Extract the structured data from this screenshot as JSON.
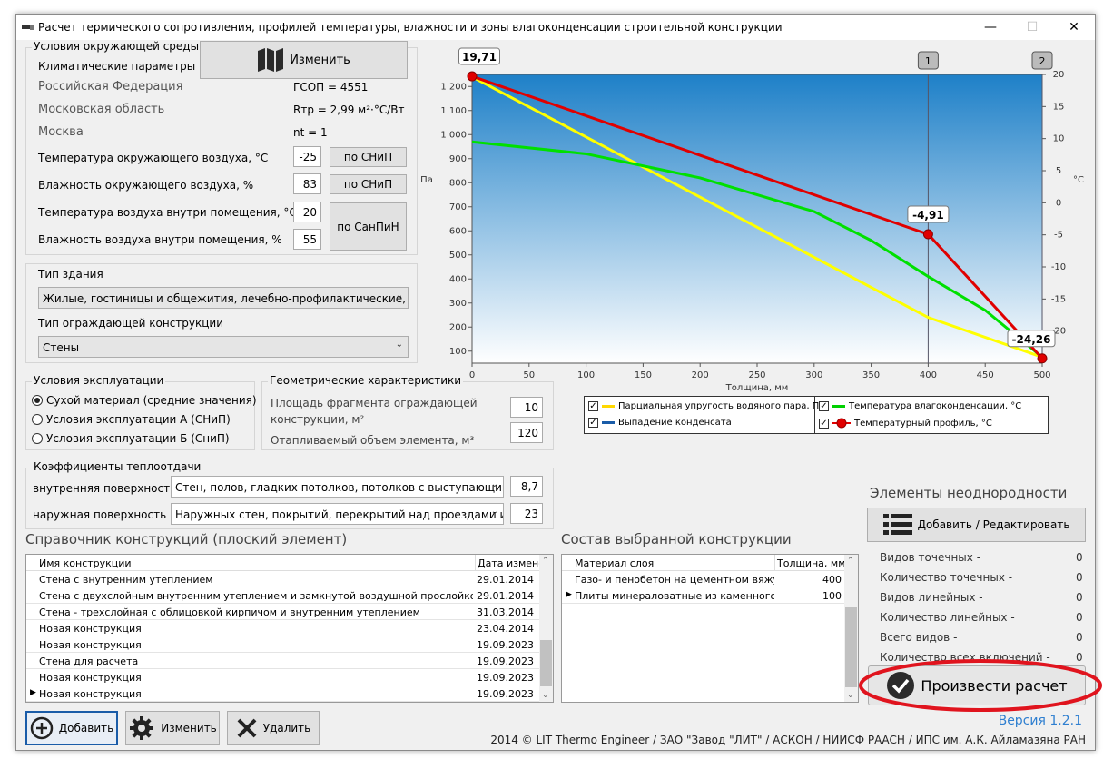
{
  "window": {
    "title": "Расчет термического сопротивления, профилей температуры, влажности и зоны влагоконденсации строительной конструкции",
    "minimize": "—",
    "maximize": "☐",
    "close": "✕"
  },
  "env": {
    "group_title": "Условия окружающей среды",
    "climate_label": "Климатические параметры",
    "change_button": "Изменить",
    "country": "Российская Федерация",
    "region": "Московская область",
    "city": "Москва",
    "gsop": "ГСОП = 4551",
    "rtr": "Rтр = 2,99 м²·°C/Вт",
    "nt": "nt = 1",
    "outside_temp_label": "Температура окружающего воздуха, °С",
    "outside_temp": "-25",
    "outside_hum_label": "Влажность окружающего воздуха, %",
    "outside_hum": "83",
    "inside_temp_label": "Температура воздуха внутри помещения, °С",
    "inside_temp": "20",
    "inside_hum_label": "Влажность воздуха внутри помещения, %",
    "inside_hum": "55",
    "snip_button": "по СНиП",
    "sanpin_button": "по СанПиН"
  },
  "building": {
    "type_label": "Тип здания",
    "type_value": "Жилые, гостиницы и общежития, лечебно-профилактические, де",
    "construction_label": "Тип ограждающей конструкции",
    "construction_value": "Стены"
  },
  "exploitation": {
    "title": "Условия эксплуатации",
    "options": [
      "Сухой материал (средние значения)",
      "Условия эксплуатации А (СНиП)",
      "Условия эксплуатации Б (СниП)"
    ]
  },
  "geometry": {
    "title": "Геометрические характеристики",
    "area_label": "Площадь фрагмента ограждающей конструкции, м²",
    "area_line1": "Площадь фрагмента ограждающей",
    "area_line2": "конструкции, м²",
    "area": "10",
    "volume_label": "Отапливаемый объем элемента, м³",
    "volume": "120"
  },
  "heat": {
    "title": "Коэффициенты теплоотдачи",
    "inner_label": "внутренняя поверхность",
    "inner_select": "Стен, полов, гладких потолков, потолков с выступающим",
    "inner_value": "8,7",
    "outer_label": "наружная поверхность",
    "outer_select": "Наружных стен, покрытий, перекрытий над проездами и",
    "outer_value": "23"
  },
  "catalog": {
    "title": "Справочник конструкций (плоский элемент)",
    "col_name": "Имя конструкции",
    "col_date": "Дата измене",
    "rows": [
      {
        "name": "Стена с внутренним утеплением",
        "date": "29.01.2014"
      },
      {
        "name": "Стена с двухслойным внутренним утеплением и замкнутой воздушной прослойкой с покрыти",
        "date": "29.01.2014"
      },
      {
        "name": "Стена - трехслойная с облицовкой кирпичом и внутренним утеплением",
        "date": "31.03.2014"
      },
      {
        "name": "Новая конструкция",
        "date": "23.04.2014"
      },
      {
        "name": "Новая конструкция",
        "date": "19.09.2023"
      },
      {
        "name": "Стена для расчета",
        "date": "19.09.2023"
      },
      {
        "name": "Новая конструкция",
        "date": "19.09.2023"
      },
      {
        "name": "Новая конструкция",
        "date": "19.09.2023"
      }
    ]
  },
  "composition": {
    "title": "Состав выбранной конструкции",
    "col_material": "Материал слоя",
    "col_thickness": "Толщина, мм",
    "rows": [
      {
        "material": "Газо- и пенобетон на цементном вяжущем",
        "thickness": "400"
      },
      {
        "material": "Плиты минераловатные из каменного волс",
        "thickness": "100"
      }
    ]
  },
  "buttons": {
    "add": "Добавить",
    "edit": "Изменить",
    "delete": "Удалить"
  },
  "inhomogeneity": {
    "title": "Элементы неоднородности",
    "add_edit_button": "Добавить / Редактировать",
    "stats": [
      {
        "label": "Видов точечных -",
        "value": "0"
      },
      {
        "label": "Количество точечных -",
        "value": "0"
      },
      {
        "label": "Видов линейных -",
        "value": "0"
      },
      {
        "label": "Количество линейных -",
        "value": "0"
      },
      {
        "label": "Всего видов -",
        "value": "0"
      },
      {
        "label": "Количество всех включений -",
        "value": "0"
      }
    ]
  },
  "calc_button": "Произвести расчет",
  "version": "Версия 1.2.1",
  "footer": "2014 © LIT Thermo Engineer / ЗАО \"Завод \"ЛИТ\" / АСКОН / НИИСФ РААСН / ИПС им. А.К. Айламазяна РАН",
  "legend": {
    "partial": "Парциальная упругость водяного пара, Па",
    "cond_temp": "Температура влагоконденсации, °С",
    "condensate": "Выпадение конденсата",
    "temp_profile": "Температурный профиль, °С"
  },
  "chart_data": {
    "type": "line",
    "xlabel": "Толщина, мм",
    "ylabel_left": "Па",
    "ylabel_right": "°С",
    "xlim": [
      0,
      500
    ],
    "ylim_left": [
      50,
      1250
    ],
    "ylim_right": [
      -25,
      20
    ],
    "x_ticks": [
      "0",
      "50",
      "100",
      "150",
      "200",
      "250",
      "300",
      "350",
      "400",
      "450",
      "500"
    ],
    "y_left_ticks": [
      "100",
      "200",
      "300",
      "400",
      "500",
      "600",
      "700",
      "800",
      "900",
      "1 000",
      "1 100",
      "1 200"
    ],
    "y_right_ticks": [
      "20",
      "15",
      "10",
      "5",
      "0",
      "-5",
      "-10",
      "-15",
      "-20"
    ],
    "layer_markers": [
      {
        "x": 400,
        "label": "1"
      },
      {
        "x": 500,
        "label": "2"
      }
    ],
    "series": [
      {
        "name": "Парциальная упругость водяного пара, Па",
        "color": "#ffff00",
        "axis": "left",
        "x": [
          0,
          400,
          500
        ],
        "y": [
          1240,
          240,
          75
        ]
      },
      {
        "name": "Температура влагоконденсации, °С",
        "color": "#00e000",
        "axis": "left",
        "x": [
          0,
          100,
          200,
          300,
          350,
          400,
          450,
          500
        ],
        "y": [
          970,
          920,
          820,
          680,
          560,
          410,
          270,
          75
        ]
      },
      {
        "name": "Температурный профиль, °С",
        "color": "#e00000",
        "axis": "right",
        "x": [
          0,
          400,
          500
        ],
        "y": [
          19.71,
          -4.91,
          -24.26
        ]
      }
    ],
    "point_labels": [
      {
        "x": 0,
        "y": 19.71,
        "text": "19,71"
      },
      {
        "x": 400,
        "y": -4.91,
        "text": "-4,91"
      },
      {
        "x": 500,
        "y": -24.26,
        "text": "-24,26"
      }
    ]
  }
}
